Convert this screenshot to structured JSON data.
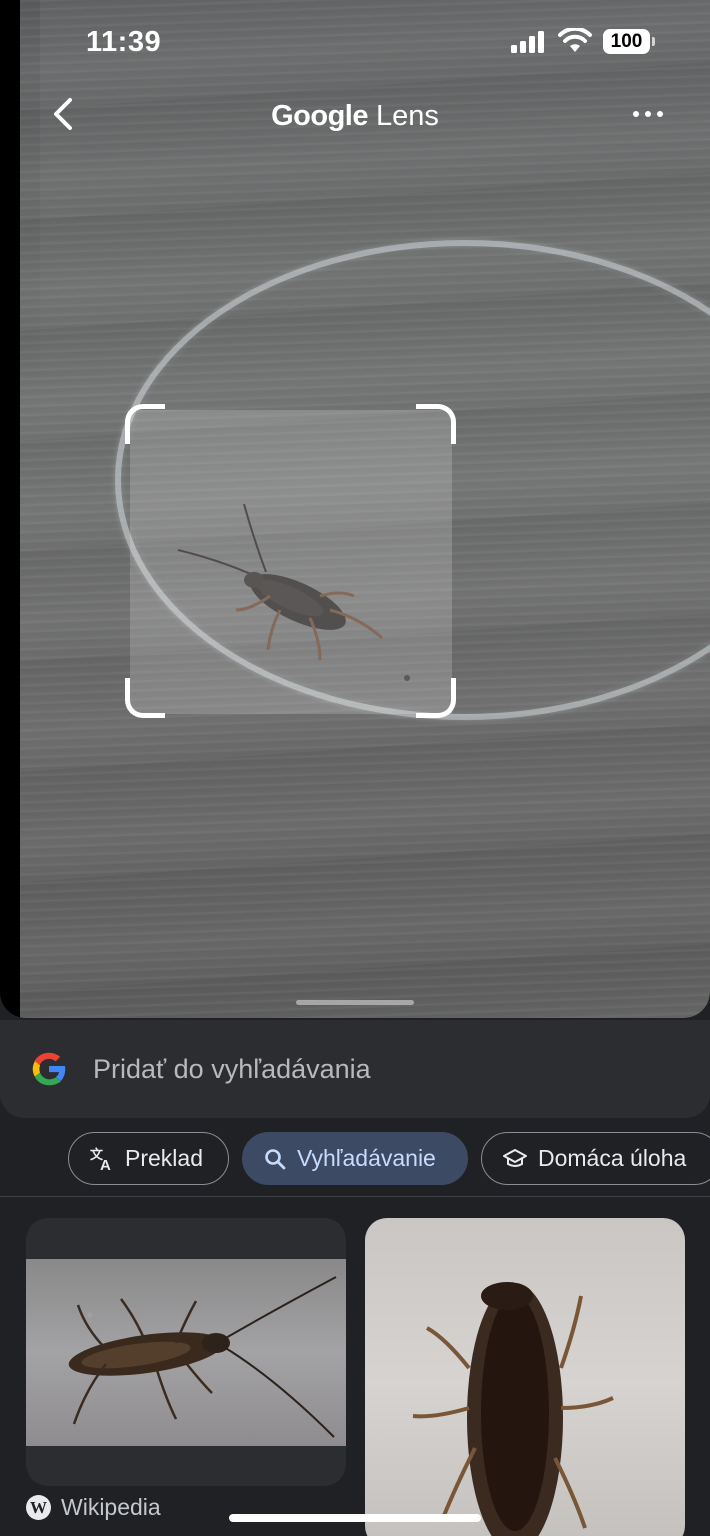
{
  "status_bar": {
    "time": "11:39",
    "battery": "100"
  },
  "app_bar": {
    "title_brand": "Google",
    "title_product": "Lens",
    "icons": {
      "back": "chevron-left-icon",
      "more": "more-horizontal-icon"
    }
  },
  "search": {
    "placeholder": "Pridať do vyhľadávania",
    "icon": "google-g-icon"
  },
  "modes": [
    {
      "label": "Preklad",
      "icon": "translate-icon",
      "active": false
    },
    {
      "label": "Vyhľadávanie",
      "icon": "search-icon",
      "active": true
    },
    {
      "label": "Domáca úloha",
      "icon": "graduation-cap-icon",
      "active": false
    }
  ],
  "results": [
    {
      "source": "Wikipedia",
      "source_icon": "wikipedia-icon"
    },
    {
      "source": ""
    }
  ],
  "colors": {
    "active_chip_bg": "#3d4a63",
    "active_chip_text": "#c7dbff",
    "sheet_bg": "#1f2125",
    "search_bar_bg": "#2b2d31"
  }
}
